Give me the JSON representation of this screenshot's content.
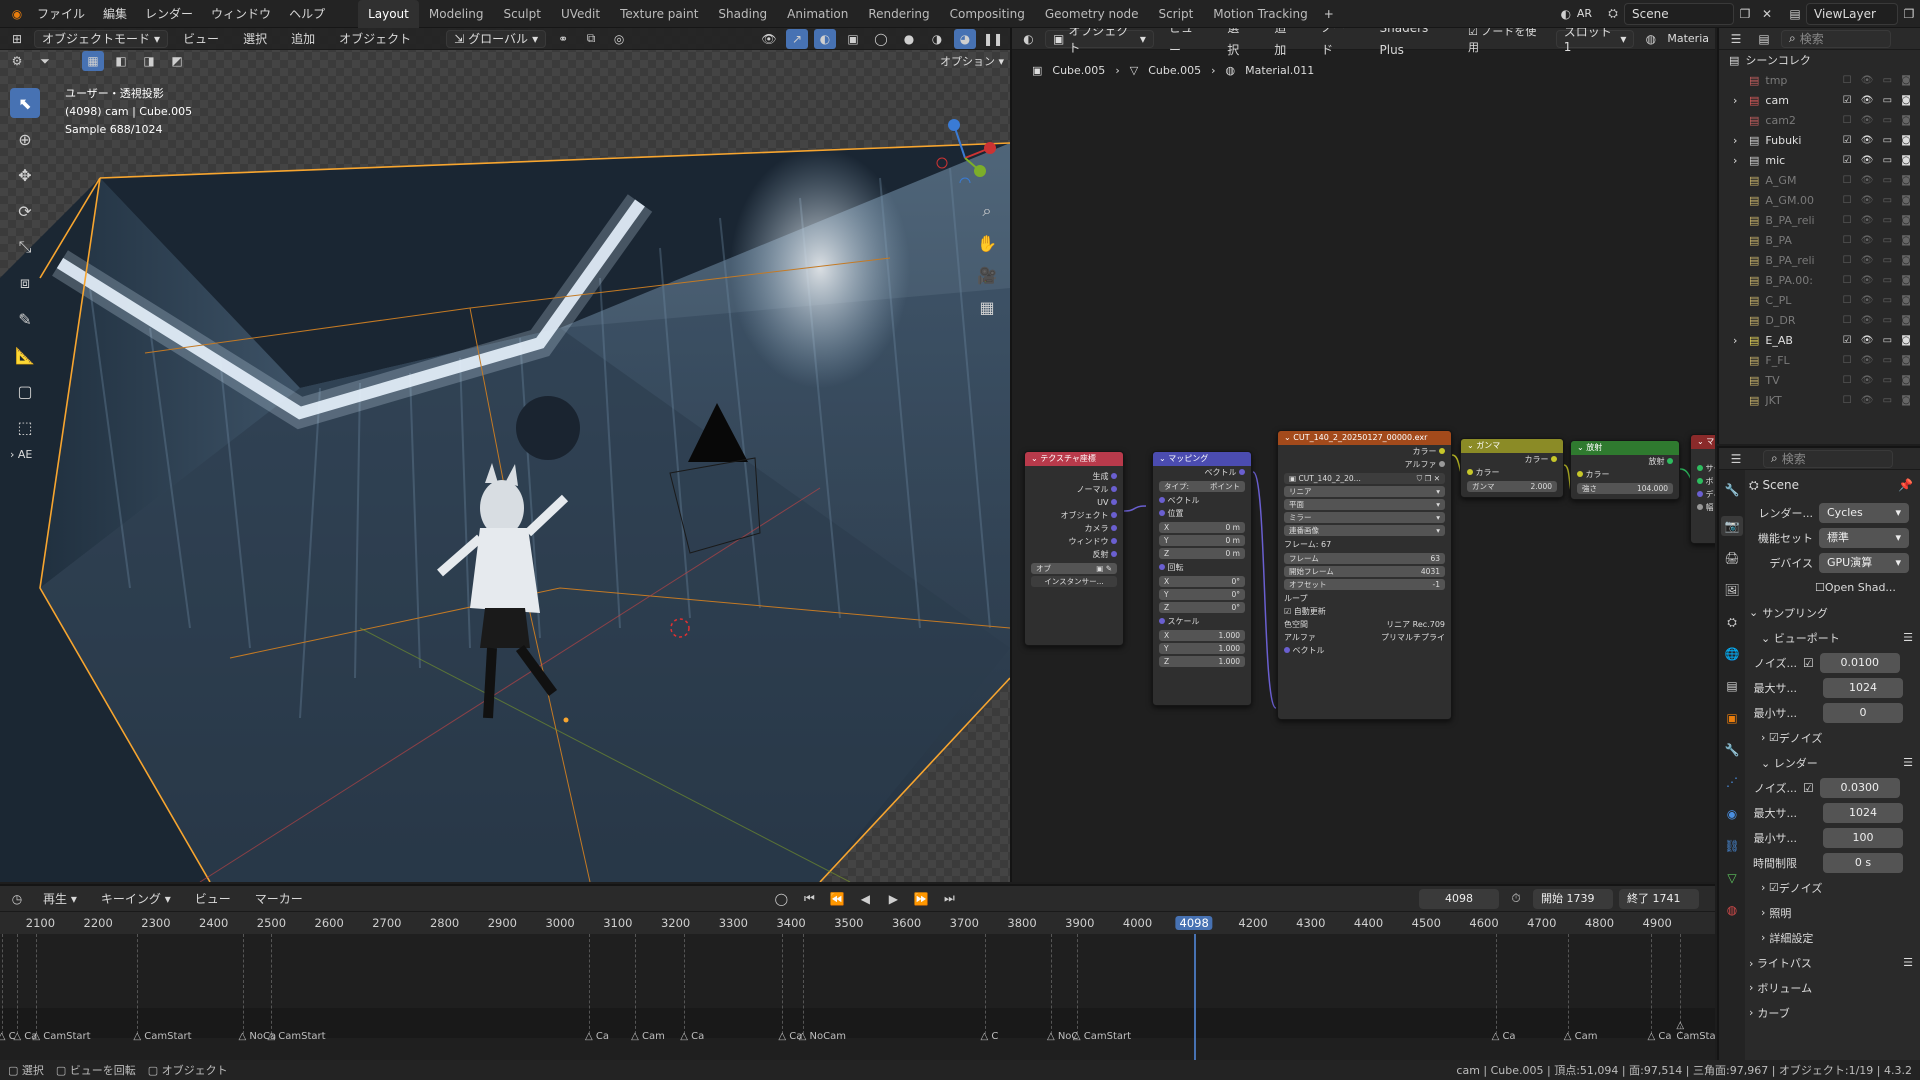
{
  "menu": [
    "ファイル",
    "編集",
    "レンダー",
    "ウィンドウ",
    "ヘルプ"
  ],
  "workspaces": [
    "Layout",
    "Modeling",
    "Sculpt",
    "UVedit",
    "Texture paint",
    "Shading",
    "Animation",
    "Rendering",
    "Compositing",
    "Geometry node",
    "Script",
    "Motion Tracking"
  ],
  "active_workspace": "Layout",
  "top_right": {
    "engine_short": "AR",
    "scene": "Scene",
    "view_layer": "ViewLayer"
  },
  "viewport": {
    "mode": "オブジェクトモード",
    "menus": [
      "ビュー",
      "選択",
      "追加",
      "オブジェクト"
    ],
    "transform": "グローバル",
    "options": "オプション",
    "info_line1": "ユーザー・透視投影",
    "info_line2": "(4098) cam | Cube.005",
    "info_line3": "Sample 688/1024",
    "side_label": "AE"
  },
  "node_editor": {
    "object": "オブジェクト",
    "menus": [
      "ビュー",
      "選択",
      "追加",
      "ノード"
    ],
    "addon": "Shaders Plus",
    "use_nodes": "ノードを使用",
    "slot": "スロット1",
    "material_short": "Materia",
    "breadcrumb": [
      "Cube.005",
      "Cube.005",
      "Material.011"
    ],
    "nodes": {
      "texcoord": {
        "title": "テクスチャ座標",
        "outputs": [
          "生成",
          "ノーマル",
          "UV",
          "オブジェクト",
          "カメラ",
          "ウィンドウ",
          "反射"
        ],
        "object_label": "オブ",
        "instancer": "インスタンサー..."
      },
      "mapping": {
        "title": "マッピング",
        "out": "ベクトル",
        "type_label": "タイプ:",
        "type_val": "ポイント",
        "vector": "ベクトル",
        "location": "位置",
        "rotation": "回転",
        "scale": "スケール",
        "loc": [
          [
            "X",
            "0 m"
          ],
          [
            "Y",
            "0 m"
          ],
          [
            "Z",
            "0 m"
          ]
        ],
        "rot": [
          [
            "X",
            "0°"
          ],
          [
            "Y",
            "0°"
          ],
          [
            "Z",
            "0°"
          ]
        ],
        "scl": [
          [
            "X",
            "1.000"
          ],
          [
            "Y",
            "1.000"
          ],
          [
            "Z",
            "1.000"
          ]
        ]
      },
      "image": {
        "title": "CUT_140_2_20250127_00000.exr",
        "out_color": "カラー",
        "out_alpha": "アルファ",
        "file": "CUT_140_2_20...",
        "interp": "リニア",
        "proj": "平面",
        "ext": "ミラー",
        "source": "連番画像",
        "frames_info": "フレーム: 67",
        "frames": [
          [
            "フレーム",
            "63"
          ],
          [
            "開始フレーム",
            "4031"
          ],
          [
            "オフセット",
            "-1"
          ]
        ],
        "loop": "ループ",
        "auto": "自動更新",
        "colorspace_label": "色空間",
        "colorspace": "リニア Rec.709",
        "alpha_label": "アルファ",
        "alpha": "プリマルチプライ",
        "vector": "ベクトル"
      },
      "gamma": {
        "title": "ガンマ",
        "out": "カラー",
        "in_color": "カラー",
        "gamma_label": "ガンマ",
        "gamma_val": "2.000"
      },
      "emission": {
        "title": "放射",
        "out": "放射",
        "in_color": "カラー",
        "strength_label": "強さ",
        "strength_val": "104.000"
      },
      "partial": {
        "title": "マ",
        "rows": [
          "サー",
          "ボリ",
          "ディ",
          "幅"
        ],
        "out": "す"
      }
    }
  },
  "outliner": {
    "title": "シーンコレク",
    "items": [
      {
        "name": "tmp",
        "dim": true,
        "color": "#c45f5f"
      },
      {
        "name": "cam",
        "dim": false,
        "color": "#d85a5a"
      },
      {
        "name": "cam2",
        "dim": true,
        "color": "#c45f5f"
      },
      {
        "name": "Fubuki",
        "dim": false,
        "color": "#cfcfcf"
      },
      {
        "name": "mic",
        "dim": false,
        "color": "#cfcfcf"
      },
      {
        "name": "A_GM",
        "dim": true,
        "color": "#c8b26b"
      },
      {
        "name": "A_GM.00",
        "dim": true,
        "color": "#c8b26b"
      },
      {
        "name": "B_PA_reli",
        "dim": true,
        "color": "#c8b26b"
      },
      {
        "name": "B_PA",
        "dim": true,
        "color": "#c8b26b"
      },
      {
        "name": "B_PA_reli",
        "dim": true,
        "color": "#c8b26b"
      },
      {
        "name": "B_PA.00:",
        "dim": true,
        "color": "#c8b26b"
      },
      {
        "name": "C_PL",
        "dim": true,
        "color": "#c8b26b"
      },
      {
        "name": "D_DR",
        "dim": true,
        "color": "#c8b26b"
      },
      {
        "name": "E_AB",
        "dim": false,
        "color": "#e5d35a"
      },
      {
        "name": "F_FL",
        "dim": true,
        "color": "#c8b26b"
      },
      {
        "name": "TV",
        "dim": true,
        "color": "#c8b26b"
      },
      {
        "name": "JKT",
        "dim": true,
        "color": "#c8b26b"
      }
    ]
  },
  "properties": {
    "search": "検索",
    "scene": "Scene",
    "render_engine_label": "レンダー...",
    "render_engine": "Cycles",
    "feature_label": "機能セット",
    "feature": "標準",
    "device_label": "デバイス",
    "device": "GPU演算",
    "open_shading": "Open Shad...",
    "sampling": "サンプリング",
    "viewport": "ビューポート",
    "vp_noise_label": "ノイズ...",
    "vp_noise": "0.0100",
    "vp_max_label": "最大サ...",
    "vp_max": "1024",
    "vp_min_label": "最小サ...",
    "vp_min": "0",
    "denoise": "デノイズ",
    "render": "レンダー",
    "r_noise_label": "ノイズ...",
    "r_noise": "0.0300",
    "r_max_label": "最大サ...",
    "r_max": "1024",
    "r_min_label": "最小サ...",
    "r_min": "100",
    "time_label": "時間制限",
    "time": "0 s",
    "denoise2": "デノイズ",
    "lights": "照明",
    "advanced": "詳細設定",
    "lightpaths": "ライトパス",
    "volumes": "ボリューム",
    "curves": "カーブ"
  },
  "timeline": {
    "menus": [
      "再生",
      "キーイング",
      "ビュー",
      "マーカー"
    ],
    "current_frame": "4098",
    "start_label": "開始",
    "start": "1739",
    "end_label": "終了",
    "end": "1741",
    "ticks": [
      "2100",
      "2200",
      "2300",
      "2400",
      "2500",
      "2600",
      "2700",
      "2800",
      "2900",
      "3000",
      "3100",
      "3200",
      "3300",
      "3400",
      "3500",
      "3600",
      "3700",
      "3800",
      "3900",
      "4000",
      "4098",
      "4200",
      "4300",
      "4400",
      "4500",
      "4600",
      "4700",
      "4800",
      "4900"
    ],
    "markers": [
      {
        "label": "C",
        "frame": 2033
      },
      {
        "label": "Ca",
        "frame": 2060
      },
      {
        "label": "CamStart",
        "frame": 2093
      },
      {
        "label": "CamStart",
        "frame": 2268
      },
      {
        "label": "NoCa",
        "frame": 2450
      },
      {
        "label": "CamStart",
        "frame": 2500
      },
      {
        "label": "Ca",
        "frame": 3050
      },
      {
        "label": "Cam",
        "frame": 3130
      },
      {
        "label": "Ca",
        "frame": 3215
      },
      {
        "label": "Ca",
        "frame": 3385
      },
      {
        "label": "NoCam",
        "frame": 3420
      },
      {
        "label": "C",
        "frame": 3735
      },
      {
        "label": "NoC",
        "frame": 3850
      },
      {
        "label": "CamStart",
        "frame": 3895
      },
      {
        "label": "Ca",
        "frame": 4620
      },
      {
        "label": "Cam",
        "frame": 4745
      },
      {
        "label": "Ca",
        "frame": 4890
      },
      {
        "label": "CamStart",
        "frame": 4940
      }
    ]
  },
  "status": {
    "left": [
      "選択",
      "ビューを回転",
      "オブジェクト"
    ],
    "right": "cam | Cube.005 | 頂点:51,094 | 面:97,514 | 三角面:97,967 | オブジェクト:1/19 | 4.3.2"
  },
  "colors": {
    "accent": "#4772b3",
    "selection": "#f7a52f",
    "texcoord": "#b83a4b",
    "mapping": "#4b4cb0",
    "image": "#a34a1b",
    "gamma": "#8b8b26",
    "emission": "#2f7a2f"
  }
}
